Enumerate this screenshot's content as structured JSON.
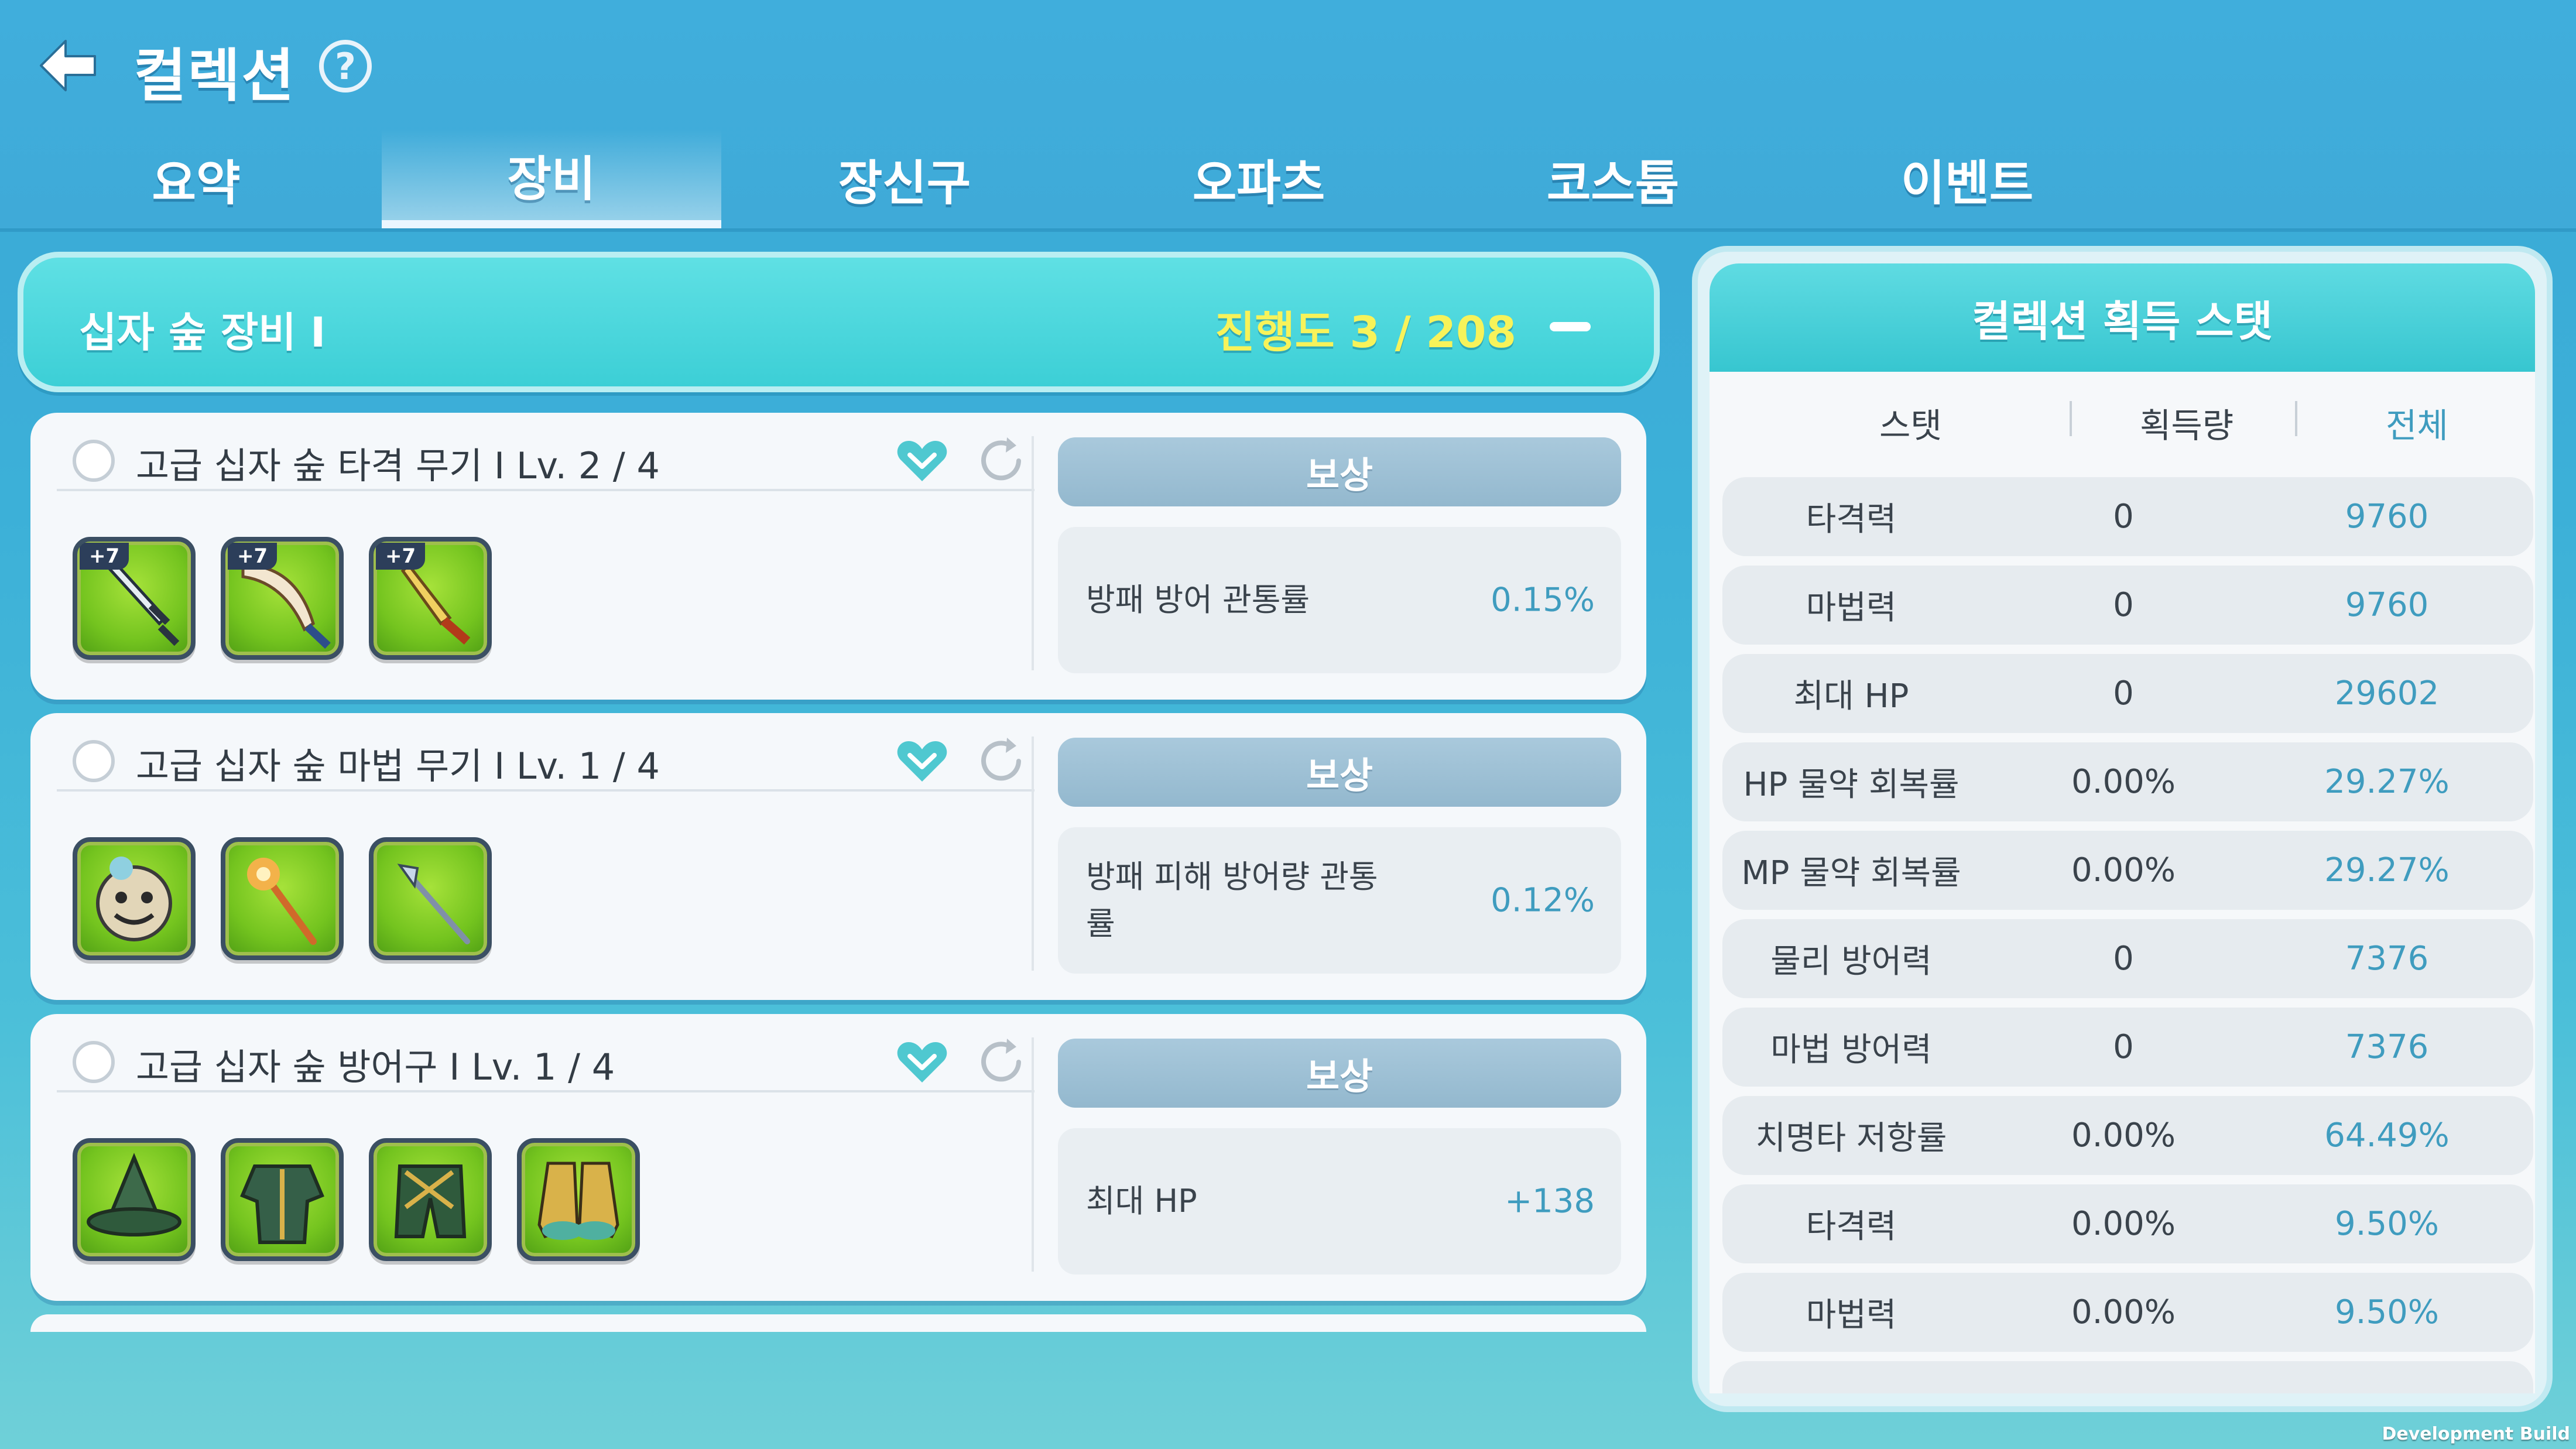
{
  "header": {
    "title": "컬렉션",
    "help_icon": "question-circle-icon",
    "back_icon": "back-arrow-icon"
  },
  "tabs": [
    {
      "label": "요약",
      "active": false
    },
    {
      "label": "장비",
      "active": true
    },
    {
      "label": "장신구",
      "active": false
    },
    {
      "label": "오파츠",
      "active": false
    },
    {
      "label": "코스튬",
      "active": false
    },
    {
      "label": "이벤트",
      "active": false
    }
  ],
  "set": {
    "name": "십자 숲 장비 I",
    "progress": "진행도 3 / 208"
  },
  "cards": [
    {
      "title": "고급 십자 숲 타격 무기 I Lv. 2 / 4",
      "items": [
        {
          "icon": "greatsword-icon",
          "enhance": "+7"
        },
        {
          "icon": "curved-blade-icon",
          "enhance": "+7"
        },
        {
          "icon": "dagger-icon",
          "enhance": "+7"
        }
      ],
      "reward_label": "보상",
      "reward_name": "방패 방어 관통률",
      "reward_value": "0.15%"
    },
    {
      "title": "고급 십자 숲 마법 무기 I Lv. 1 / 4",
      "items": [
        {
          "icon": "mask-orb-icon",
          "enhance": ""
        },
        {
          "icon": "flower-staff-icon",
          "enhance": ""
        },
        {
          "icon": "wand-icon",
          "enhance": ""
        }
      ],
      "reward_label": "보상",
      "reward_name": "방패 피해 방어량 관통률",
      "reward_value": "0.12%"
    },
    {
      "title": "고급 십자 숲 방어구 I Lv. 1 / 4",
      "items": [
        {
          "icon": "wizard-hat-icon",
          "enhance": ""
        },
        {
          "icon": "armor-robe-icon",
          "enhance": ""
        },
        {
          "icon": "pants-icon",
          "enhance": ""
        },
        {
          "icon": "boots-icon",
          "enhance": ""
        }
      ],
      "reward_label": "보상",
      "reward_name": "최대 HP",
      "reward_value": "+138"
    }
  ],
  "stat_panel": {
    "title": "컬렉션 획득 스탯",
    "columns": [
      "스탯",
      "획득량",
      "전체"
    ],
    "rows": [
      {
        "name": "타격력",
        "gain": "0",
        "total": "9760"
      },
      {
        "name": "마법력",
        "gain": "0",
        "total": "9760"
      },
      {
        "name": "최대 HP",
        "gain": "0",
        "total": "29602"
      },
      {
        "name": "HP 물약 회복률",
        "gain": "0.00%",
        "total": "29.27%"
      },
      {
        "name": "MP 물약 회복률",
        "gain": "0.00%",
        "total": "29.27%"
      },
      {
        "name": "물리 방어력",
        "gain": "0",
        "total": "7376"
      },
      {
        "name": "마법 방어력",
        "gain": "0",
        "total": "7376"
      },
      {
        "name": "치명타 저항률",
        "gain": "0.00%",
        "total": "64.49%"
      },
      {
        "name": "타격력",
        "gain": "0.00%",
        "total": "9.50%"
      },
      {
        "name": "마법력",
        "gain": "0.00%",
        "total": "9.50%"
      }
    ]
  },
  "footer": {
    "build_label": "Development Build"
  },
  "colors": {
    "accent_teal": "#3ccfd6",
    "progress_yellow": "#f7f35a",
    "value_blue": "#3f9cbf",
    "heart_teal": "#4fc8d0"
  }
}
